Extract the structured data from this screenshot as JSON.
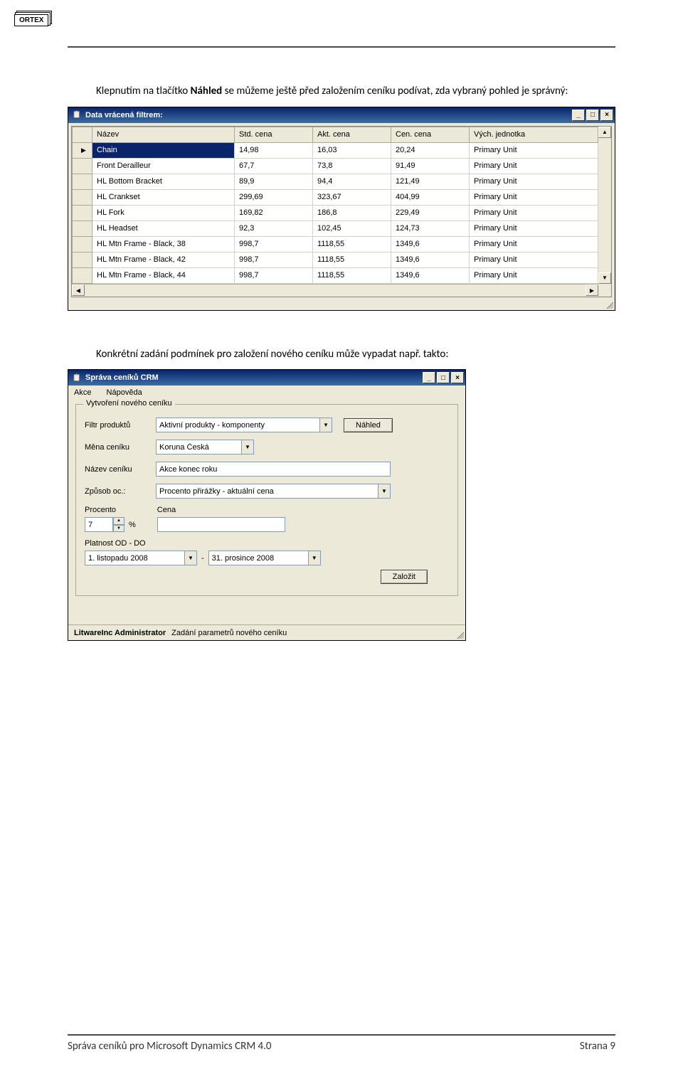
{
  "header": {
    "logo_text": "ORTEX"
  },
  "paragraph1": {
    "pre": "Klepnutím na tlačítko ",
    "bold": "Náhled",
    "post": " se můžeme ještě před založením ceníku podívat, zda vybraný pohled je správný:"
  },
  "grid_dialog": {
    "title": "Data vrácená filtrem:",
    "columns": [
      "Název",
      "Std. cena",
      "Akt. cena",
      "Cen. cena",
      "Vých. jednotka"
    ],
    "rows": [
      {
        "name": "Chain",
        "std": "14,98",
        "akt": "16,03",
        "cen": "20,24",
        "unit": "Primary Unit",
        "selected": true
      },
      {
        "name": "Front Derailleur",
        "std": "67,7",
        "akt": "73,8",
        "cen": "91,49",
        "unit": "Primary Unit"
      },
      {
        "name": "HL Bottom Bracket",
        "std": "89,9",
        "akt": "94,4",
        "cen": "121,49",
        "unit": "Primary Unit"
      },
      {
        "name": "HL Crankset",
        "std": "299,69",
        "akt": "323,67",
        "cen": "404,99",
        "unit": "Primary Unit"
      },
      {
        "name": "HL Fork",
        "std": "169,82",
        "akt": "186,8",
        "cen": "229,49",
        "unit": "Primary Unit"
      },
      {
        "name": "HL Headset",
        "std": "92,3",
        "akt": "102,45",
        "cen": "124,73",
        "unit": "Primary Unit"
      },
      {
        "name": "HL Mtn Frame - Black, 38",
        "std": "998,7",
        "akt": "1118,55",
        "cen": "1349,6",
        "unit": "Primary Unit"
      },
      {
        "name": "HL Mtn Frame - Black, 42",
        "std": "998,7",
        "akt": "1118,55",
        "cen": "1349,6",
        "unit": "Primary Unit"
      },
      {
        "name": "HL Mtn Frame - Black, 44",
        "std": "998,7",
        "akt": "1118,55",
        "cen": "1349,6",
        "unit": "Primary Unit"
      }
    ]
  },
  "paragraph2": "Konkrétní zadání podmínek pro založení nového ceníku může vypadat např. takto:",
  "form_dialog": {
    "title": "Správa ceníků CRM",
    "menu": {
      "akce": "Akce",
      "napoveda": "Nápověda"
    },
    "group_legend": "Vytvoření nového ceníku",
    "labels": {
      "filtr": "Filtr produktů",
      "mena": "Měna ceníku",
      "nazev": "Název ceníku",
      "zpusob": "Způsob oc.:",
      "procento": "Procento",
      "cena": "Cena",
      "platnost": "Platnost OD - DO"
    },
    "values": {
      "filtr": "Aktivní produkty - komponenty",
      "mena": "Koruna Česká",
      "nazev": "Akce konec roku",
      "zpusob": "Procento přirážky - aktuální cena",
      "procento": "7",
      "procento_unit": "%",
      "cena": "",
      "date_from": "1. listopadu 2008",
      "date_to": "31. prosince 2008"
    },
    "buttons": {
      "nahled": "Náhled",
      "zalozit": "Založit"
    },
    "status": {
      "user": "LitwareInc Administrator",
      "text": "Zadání parametrů nového ceníku"
    }
  },
  "footer": {
    "left": "Správa ceníků pro Microsoft Dynamics CRM 4.0",
    "right": "Strana 9"
  }
}
